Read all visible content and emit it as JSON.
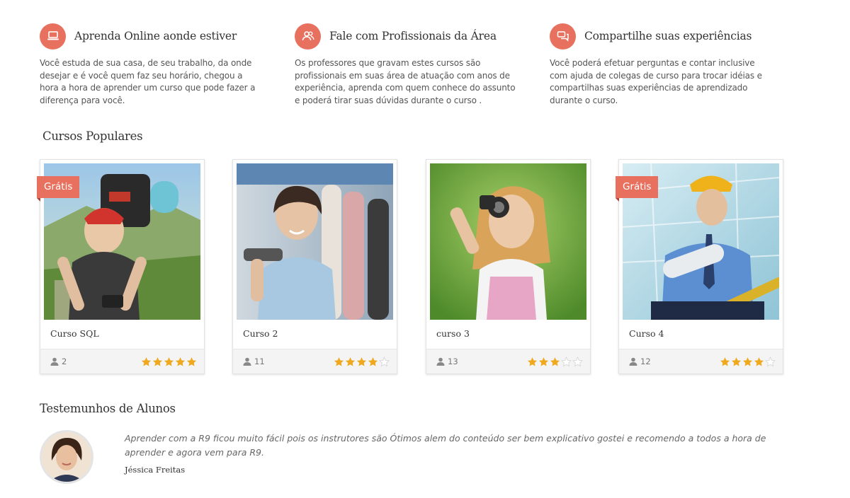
{
  "features": [
    {
      "icon": "laptop-icon",
      "title": "Aprenda Online aonde estiver",
      "text": "Você estuda de sua casa, de seu trabalho, da onde desejar e é você quem faz seu horário, chegou a hora a hora de aprender um curso que pode fazer a diferença para você."
    },
    {
      "icon": "users-icon",
      "title": "Fale com Profissionais da Área",
      "text": "Os professores que gravam estes cursos são profissionais em suas área de atuação com anos de experiência, aprenda com quem conhece do assunto e poderá tirar suas dúvidas durante o curso ."
    },
    {
      "icon": "chat-icon",
      "title": "Compartilhe suas experiências",
      "text": "Você poderá efetuar perguntas e contar inclusive com ajuda de colegas de curso para trocar idéias e compartilhas suas experiências de aprendizado durante o curso."
    }
  ],
  "courses_section": {
    "title": "Cursos Populares"
  },
  "courses": [
    {
      "title": "Curso SQL",
      "badge": "Grátis",
      "students": "2",
      "rating": 5
    },
    {
      "title": "Curso 2",
      "badge": "",
      "students": "11",
      "rating": 4
    },
    {
      "title": "curso 3",
      "badge": "",
      "students": "13",
      "rating": 3
    },
    {
      "title": "Curso 4",
      "badge": "Grátis",
      "students": "12",
      "rating": 4
    }
  ],
  "testimonials_section": {
    "title": "Testemunhos de Alunos"
  },
  "testimonial": {
    "quote": "Aprender com  a R9 ficou muito  fácil pois  os  instrutores  são Ótimos alem do conteúdo ser  bem explicativo  gostei e recomendo a todos a hora de aprender e agora  vem para  R9.",
    "author": "Jéssica Freitas"
  },
  "colors": {
    "accent": "#e8705f",
    "star": "#f0a81c",
    "star_empty": "#d6d6d6"
  }
}
